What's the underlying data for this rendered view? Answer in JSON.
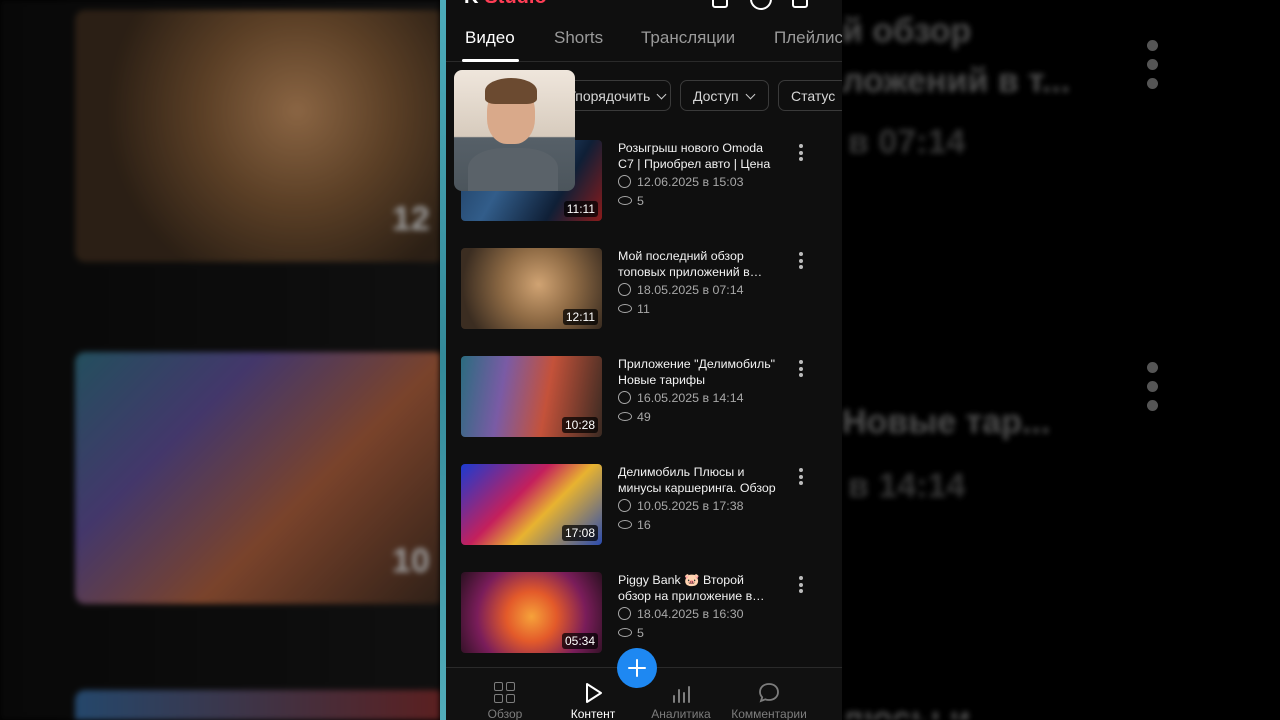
{
  "app": {
    "logo_letter": "K",
    "logo_name": "Studio"
  },
  "tabs": [
    "Видео",
    "Shorts",
    "Трансляции",
    "Плейлисты"
  ],
  "filters": [
    "Упорядочить",
    "Доступ",
    "Статус"
  ],
  "videos": [
    {
      "title": "Розыгрыш нового Omoda C7 | Приобрел авто | Цена",
      "date": "12.06.2025 в 15:03",
      "views": "5",
      "duration": "11:11"
    },
    {
      "title": "Мой последний обзор топовых приложений в телефоне",
      "date": "18.05.2025 в 07:14",
      "views": "11",
      "duration": "12:11"
    },
    {
      "title": "Приложение \"Делимобиль\" Новые тарифы",
      "date": "16.05.2025 в 14:14",
      "views": "49",
      "duration": "10:28"
    },
    {
      "title": "Делимобиль Плюсы и минусы каршеринга. Обзор",
      "date": "10.05.2025 в 17:38",
      "views": "16",
      "duration": "17:08"
    },
    {
      "title": "Piggy Bank 🐷 Второй обзор на приложение в телефоне",
      "date": "18.04.2025 в 16:30",
      "views": "5",
      "duration": "05:34"
    }
  ],
  "bottom_nav": [
    {
      "label": "Обзор",
      "icon": "grid-icon"
    },
    {
      "label": "Контент",
      "icon": "play-icon"
    },
    {
      "label": "Аналитика",
      "icon": "bar-chart-icon"
    },
    {
      "label": "Комментарии",
      "icon": "comment-icon"
    }
  ],
  "background": {
    "duration_1": "12",
    "duration_2": "10",
    "text_1": "й обзор",
    "text_2": "ложений в т...",
    "text_3": "в 07:14",
    "text_4": "Новые тар...",
    "text_5": "в 14:14",
    "text_6": "люсы и"
  },
  "colors": {
    "accent": "#1e88f2",
    "brand": "#ff3d55"
  }
}
